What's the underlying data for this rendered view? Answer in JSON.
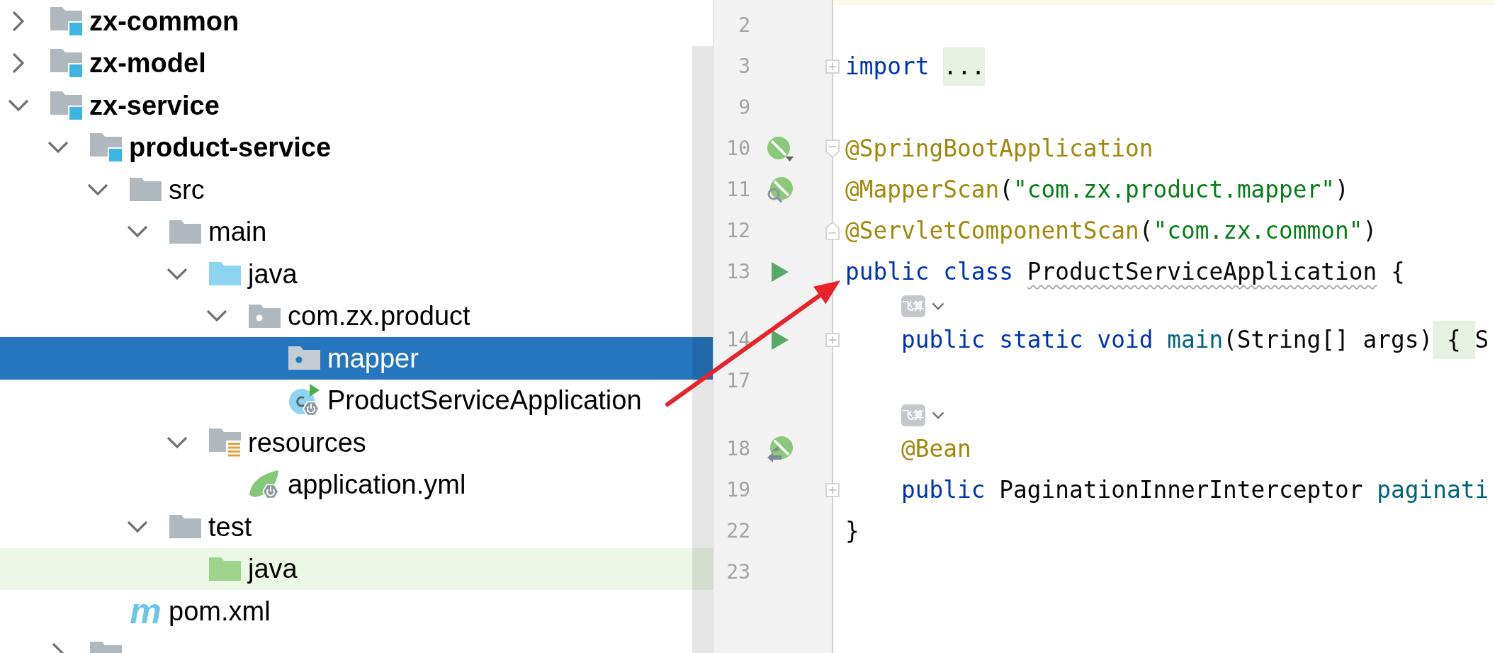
{
  "project_tree": [
    {
      "label": "zx-common",
      "kind": "module",
      "expanded": false,
      "selected": false
    },
    {
      "label": "zx-model",
      "kind": "module",
      "expanded": false,
      "selected": false
    },
    {
      "label": "zx-service",
      "kind": "module",
      "expanded": true,
      "selected": false,
      "children": [
        {
          "label": "product-service",
          "kind": "module",
          "expanded": true,
          "selected": false,
          "children": [
            {
              "label": "src",
              "kind": "folder",
              "expanded": true,
              "selected": false,
              "children": [
                {
                  "label": "main",
                  "kind": "folder",
                  "expanded": true,
                  "selected": false,
                  "children": [
                    {
                      "label": "java",
                      "kind": "source-root",
                      "expanded": true,
                      "selected": false,
                      "children": [
                        {
                          "label": "com.zx.product",
                          "kind": "package",
                          "expanded": true,
                          "selected": false,
                          "children": [
                            {
                              "label": "mapper",
                              "kind": "package",
                              "selected": true
                            },
                            {
                              "label": "ProductServiceApplication",
                              "kind": "spring-class",
                              "selected": false
                            }
                          ]
                        }
                      ]
                    },
                    {
                      "label": "resources",
                      "kind": "resources-root",
                      "expanded": true,
                      "selected": false,
                      "children": [
                        {
                          "label": "application.yml",
                          "kind": "spring-config",
                          "selected": false
                        }
                      ]
                    }
                  ]
                },
                {
                  "label": "test",
                  "kind": "folder",
                  "expanded": true,
                  "selected": false,
                  "children": [
                    {
                      "label": "java",
                      "kind": "test-root",
                      "selected": false,
                      "color": "#edf7e6"
                    }
                  ]
                }
              ]
            },
            {
              "label": "pom.xml",
              "kind": "maven",
              "icon_text": "m",
              "selected": false
            }
          ]
        },
        {
          "kind": "folder",
          "expanded": false,
          "selected": false
        }
      ]
    }
  ],
  "editor": {
    "current_line_highlight": true,
    "lines": [
      {
        "kind": "code",
        "number": "2"
      },
      {
        "kind": "code",
        "number": "3",
        "fold_marker": {
          "kind": "expand"
        },
        "tokens": [
          {
            "text": "import ",
            "kind": "keyword"
          },
          {
            "text": "...",
            "kind": "folded"
          }
        ]
      },
      {
        "kind": "code",
        "number": "9"
      },
      {
        "kind": "code",
        "number": "10",
        "gutter_icon": {
          "kind": "leafmenu"
        },
        "fold_marker": {
          "kind": "start"
        },
        "tokens": [
          {
            "text": "@SpringBootApplication",
            "kind": "annotation"
          }
        ]
      },
      {
        "kind": "code",
        "number": "11",
        "gutter_icon": {
          "kind": "leafsearch"
        },
        "tokens": [
          {
            "text": "@MapperScan",
            "kind": "annotation"
          },
          {
            "text": "(",
            "kind": "plain"
          },
          {
            "text": "\"com.zx.product.mapper\"",
            "kind": "string"
          },
          {
            "text": ")",
            "kind": "plain"
          }
        ]
      },
      {
        "kind": "code",
        "number": "12",
        "fold_marker": {
          "kind": "end"
        },
        "tokens": [
          {
            "text": "@ServletComponentScan",
            "kind": "annotation"
          },
          {
            "text": "(",
            "kind": "plain"
          },
          {
            "text": "\"com.zx.common\"",
            "kind": "string"
          },
          {
            "text": ")",
            "kind": "plain"
          }
        ]
      },
      {
        "kind": "code",
        "number": "13",
        "gutter_icon": {
          "kind": "run"
        },
        "tokens": [
          {
            "text": "public class ",
            "kind": "keyword"
          },
          {
            "text": "ProductServiceApplication",
            "kind": "flagged"
          },
          {
            "text": " {",
            "kind": "plain"
          }
        ]
      },
      {
        "kind": "hint",
        "badge": "飞算"
      },
      {
        "kind": "code",
        "number": "14",
        "gutter_icon": {
          "kind": "run"
        },
        "fold_marker": {
          "kind": "expand"
        },
        "tokens": [
          {
            "text": "    public static void ",
            "kind": "keyword"
          },
          {
            "text": "main",
            "kind": "method"
          },
          {
            "text": "(String[] args)",
            "kind": "plain"
          },
          {
            "text": " { ",
            "kind": "folded"
          },
          {
            "text": "S",
            "kind": "plain"
          }
        ]
      },
      {
        "kind": "code",
        "number": "17"
      },
      {
        "kind": "hint",
        "badge": "飞算"
      },
      {
        "kind": "code",
        "number": "18",
        "gutter_icon": {
          "kind": "leafarrow"
        },
        "tokens": [
          {
            "text": "    @Bean",
            "kind": "annotation"
          }
        ]
      },
      {
        "kind": "code",
        "number": "19",
        "fold_marker": {
          "kind": "expand"
        },
        "tokens": [
          {
            "text": "    public ",
            "kind": "keyword"
          },
          {
            "text": "PaginationInnerInterceptor ",
            "kind": "plain"
          },
          {
            "text": "paginati",
            "kind": "method"
          }
        ]
      },
      {
        "kind": "code",
        "number": "22",
        "tokens": [
          {
            "text": "}",
            "kind": "plain"
          }
        ]
      },
      {
        "kind": "code",
        "number": "23"
      }
    ]
  },
  "annotations": [
    {
      "kind": "arrow"
    }
  ]
}
